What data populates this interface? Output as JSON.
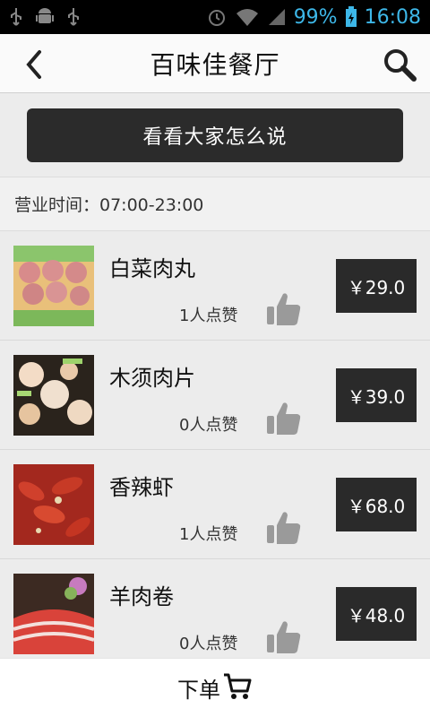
{
  "status": {
    "battery": "99%",
    "time": "16:08"
  },
  "header": {
    "title": "百味佳餐厅"
  },
  "cta": {
    "label": "看看大家怎么说"
  },
  "hours": {
    "text": "营业时间：07:00-23:00"
  },
  "menu": {
    "items": [
      {
        "name": "白菜肉丸",
        "likes": "1人点赞",
        "price": "￥29.0",
        "img": "meatball"
      },
      {
        "name": "木须肉片",
        "likes": "0人点赞",
        "price": "￥39.0",
        "img": "mushu"
      },
      {
        "name": "香辣虾",
        "likes": "1人点赞",
        "price": "￥68.0",
        "img": "shrimp"
      },
      {
        "name": "羊肉卷",
        "likes": "0人点赞",
        "price": "￥48.0",
        "img": "lamb"
      }
    ]
  },
  "bottom": {
    "order_label": "下单"
  }
}
